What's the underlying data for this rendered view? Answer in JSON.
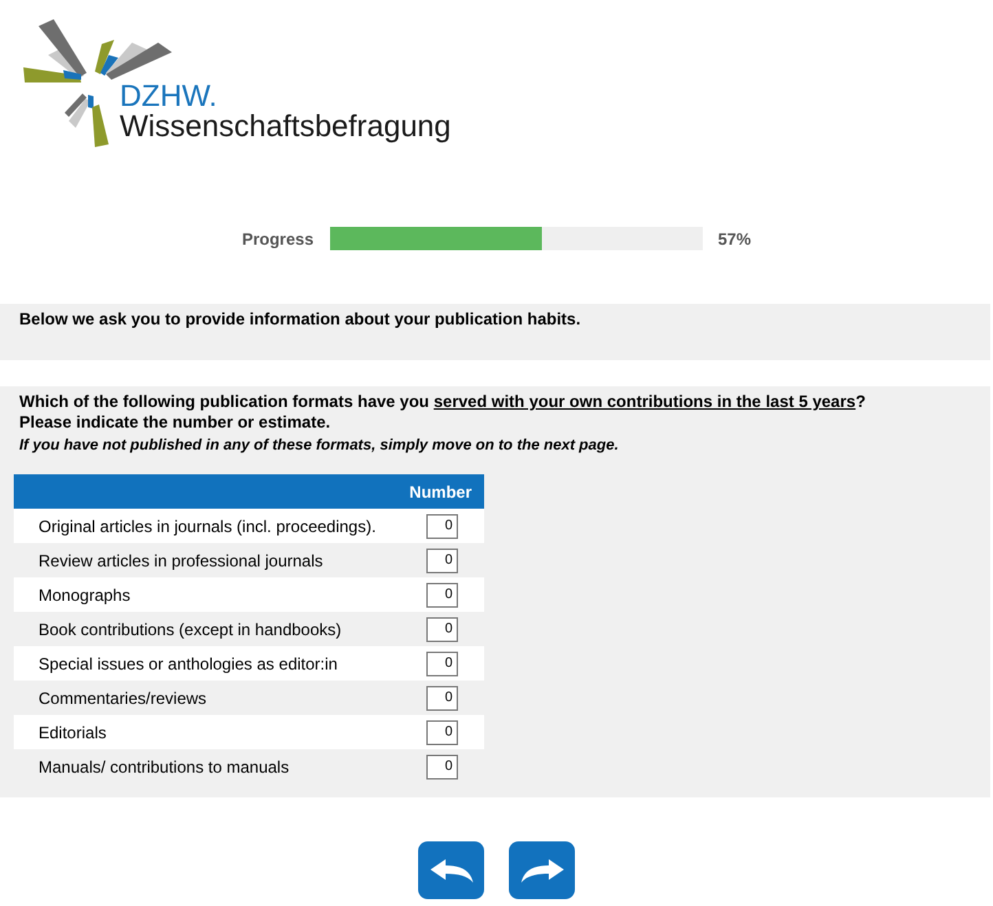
{
  "logo": {
    "acronym": "DZHW.",
    "name": "Wissenschaftsbefragung"
  },
  "progress": {
    "label": "Progress",
    "level": 0.57,
    "reading": "57%"
  },
  "intro": {
    "text": "Below we ask you to provide information about your publication habits."
  },
  "question": {
    "segments": [
      {
        "text": "Which of the following publication formats have you ",
        "underlined": false
      },
      {
        "text": "served with your own contributions in the last 5 years",
        "underlined": true
      },
      {
        "text": "?",
        "underlined": false
      }
    ],
    "instruction": "Please indicate the number or estimate.",
    "hint": "If you have not published in any of these formats, simply move on to the next page."
  },
  "table": {
    "heading": "Number",
    "rows": [
      {
        "label": "Original articles in journals (incl. proceedings).",
        "value": "0"
      },
      {
        "label": "Review articles in professional journals",
        "value": "0"
      },
      {
        "label": "Monographs",
        "value": "0"
      },
      {
        "label": "Book contributions (except in handbooks)",
        "value": "0"
      },
      {
        "label": "Special issues or anthologies as editor:in",
        "value": "0"
      },
      {
        "label": "Commentaries/reviews",
        "value": "0"
      },
      {
        "label": "Editorials",
        "value": "0"
      },
      {
        "label": "Manuals/ contributions to manuals",
        "value": "0"
      }
    ]
  },
  "navigation": [
    {
      "kind": "back"
    },
    {
      "kind": "forward"
    }
  ]
}
